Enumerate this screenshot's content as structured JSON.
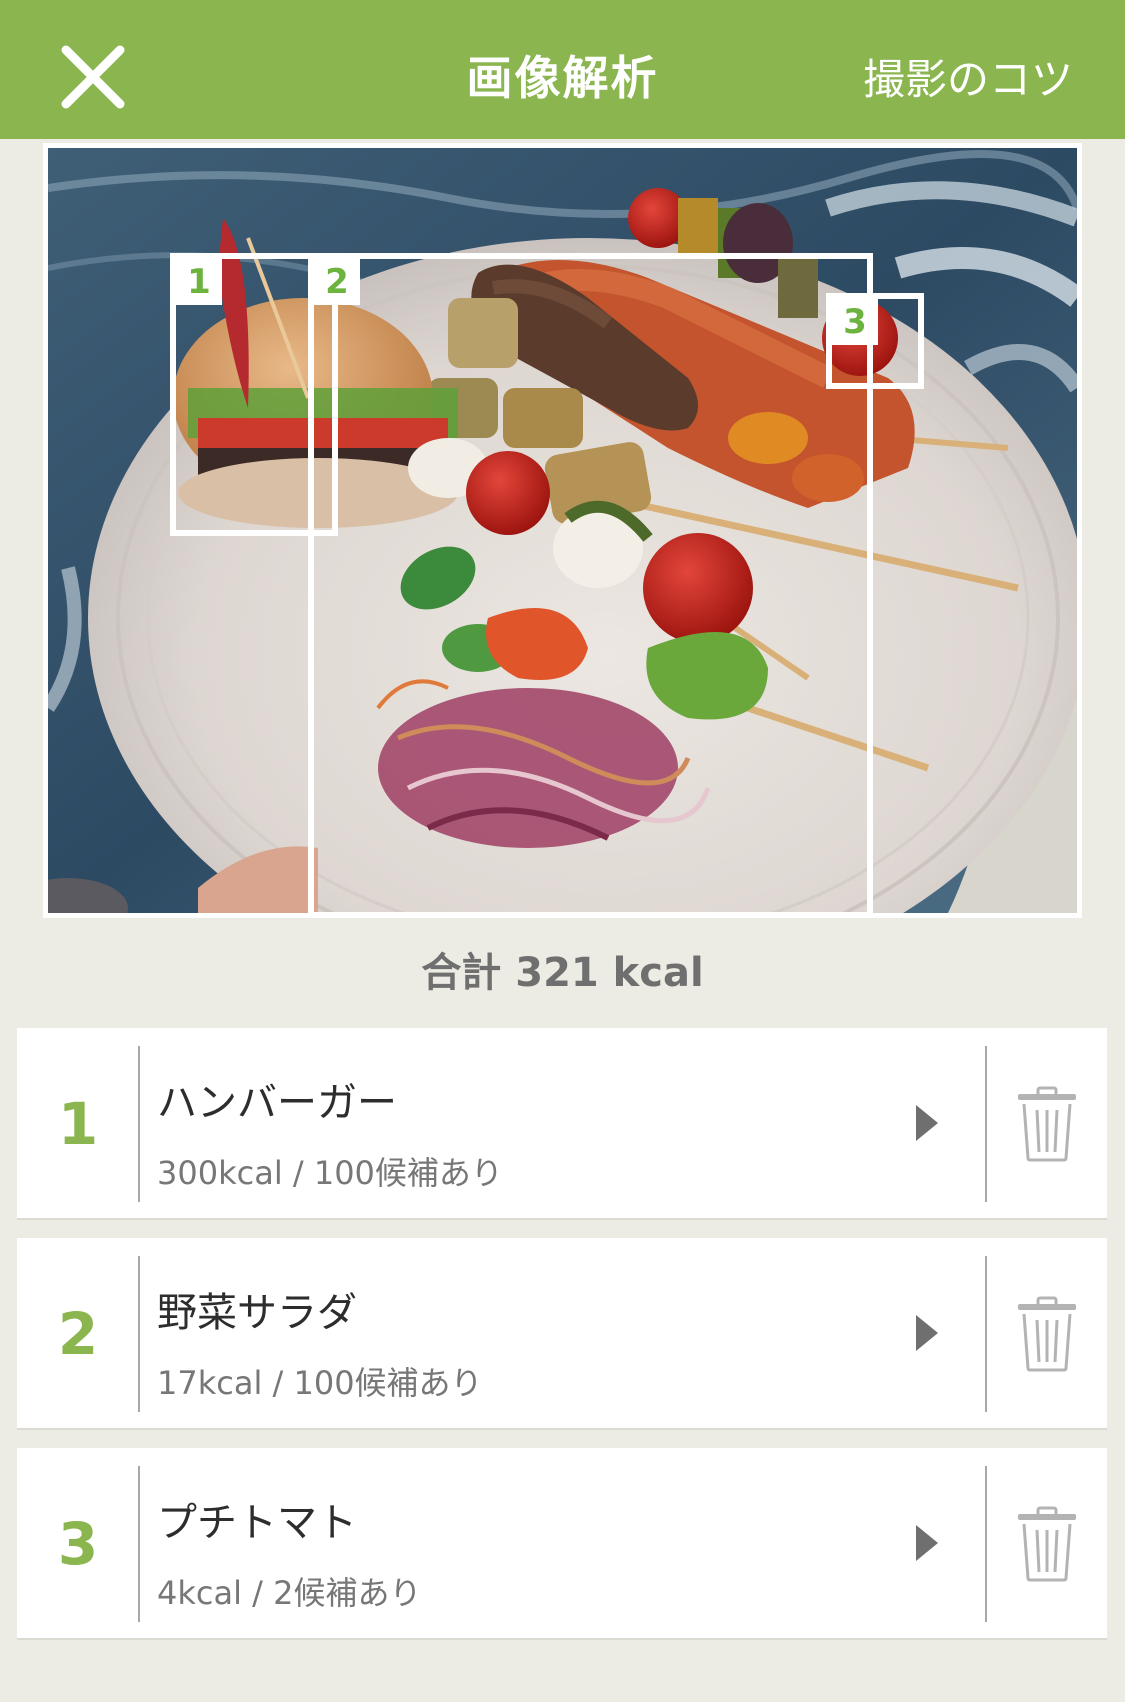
{
  "header": {
    "title": "画像解析",
    "tips_label": "撮影のコツ",
    "close_icon": "close-icon",
    "background": "#8ab54f"
  },
  "photo": {
    "icon": "food-photo",
    "boxes": [
      {
        "label": "1"
      },
      {
        "label": "2"
      },
      {
        "label": "3"
      }
    ]
  },
  "summary": {
    "total": "合計 321 kcal"
  },
  "items": [
    {
      "number": "1",
      "name": "ハンバーガー",
      "detail": "300kcal / 100候補あり"
    },
    {
      "number": "2",
      "name": "野菜サラダ",
      "detail": "17kcal / 100候補あり"
    },
    {
      "number": "3",
      "name": "プチトマト",
      "detail": "4kcal / 2候補あり"
    }
  ],
  "colors": {
    "accent": "#8ab54f",
    "number_green": "#6cb33f",
    "background": "#edece4"
  }
}
